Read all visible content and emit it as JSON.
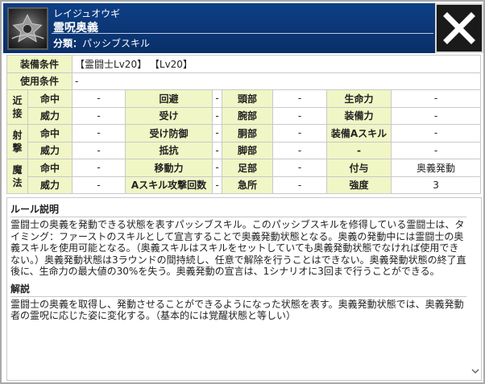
{
  "header": {
    "ruby": "レイジュオウギ",
    "skill_name": "霊呪奥義",
    "category_label": "分類：",
    "category_value": "パッシブスキル"
  },
  "equip": {
    "label": "装備条件",
    "value": "【霊闘士Lv20】 【Lv20】"
  },
  "use": {
    "label": "使用条件",
    "value": "-"
  },
  "sections": {
    "melee": "近接",
    "ranged": "射撃",
    "magic": "魔法"
  },
  "stats": {
    "hit": "命中",
    "power": "威力",
    "evasion": "回避",
    "receive": "受け",
    "guard": "受け防御",
    "resist": "抵抗",
    "movement": "移動力",
    "askill_attacks": "Aスキル攻撃回数",
    "head": "頭部",
    "arm": "腕部",
    "torso": "胴部",
    "leg": "脚部",
    "foot": "足部",
    "vital": "急所",
    "hp": "生命力",
    "equip_power": "装備力",
    "equip_askill": "装備Aスキル",
    "grant": "付与",
    "strength": "強度",
    "dash": "-",
    "grant_value": "奥義発動",
    "strength_value": "3"
  },
  "rules": {
    "title": "ルール説明",
    "text": "霊闘士の奥義を発動できる状態を表すパッシブスキル。このパッシブスキルを修得している霊闘士は、タイミング：ファーストのスキルとして宣言することで奥義発動状態となる。奥義の発動中には霊闘士の奥義スキルを使用可能となる。（奥義スキルはスキルをセットしていても奥義発動状態でなければ使用できない。）奥義発動状態は3ラウンドの間持続し、任意で解除を行うことはできない。奥義発動状態の終了直後に、生命力の最大値の30%を失う。奥義発動の宣言は、1シナリオに3回まで行うことができる。"
  },
  "explanation": {
    "title": "解説",
    "text": "霊闘士の奥義を取得し、発動させることができるようになった状態を表す。奥義発動状態では、奥義発動者の霊呪に応じた姿に変化する。（基本的には覚醒状態と等しい）"
  },
  "icons": {
    "close": "close-icon",
    "emblem": "skill-emblem-icon",
    "scroll": "chevron-down-icon"
  },
  "colors": {
    "header_bg": "#0c3a7c",
    "label_bg": "#f0f6c5"
  }
}
